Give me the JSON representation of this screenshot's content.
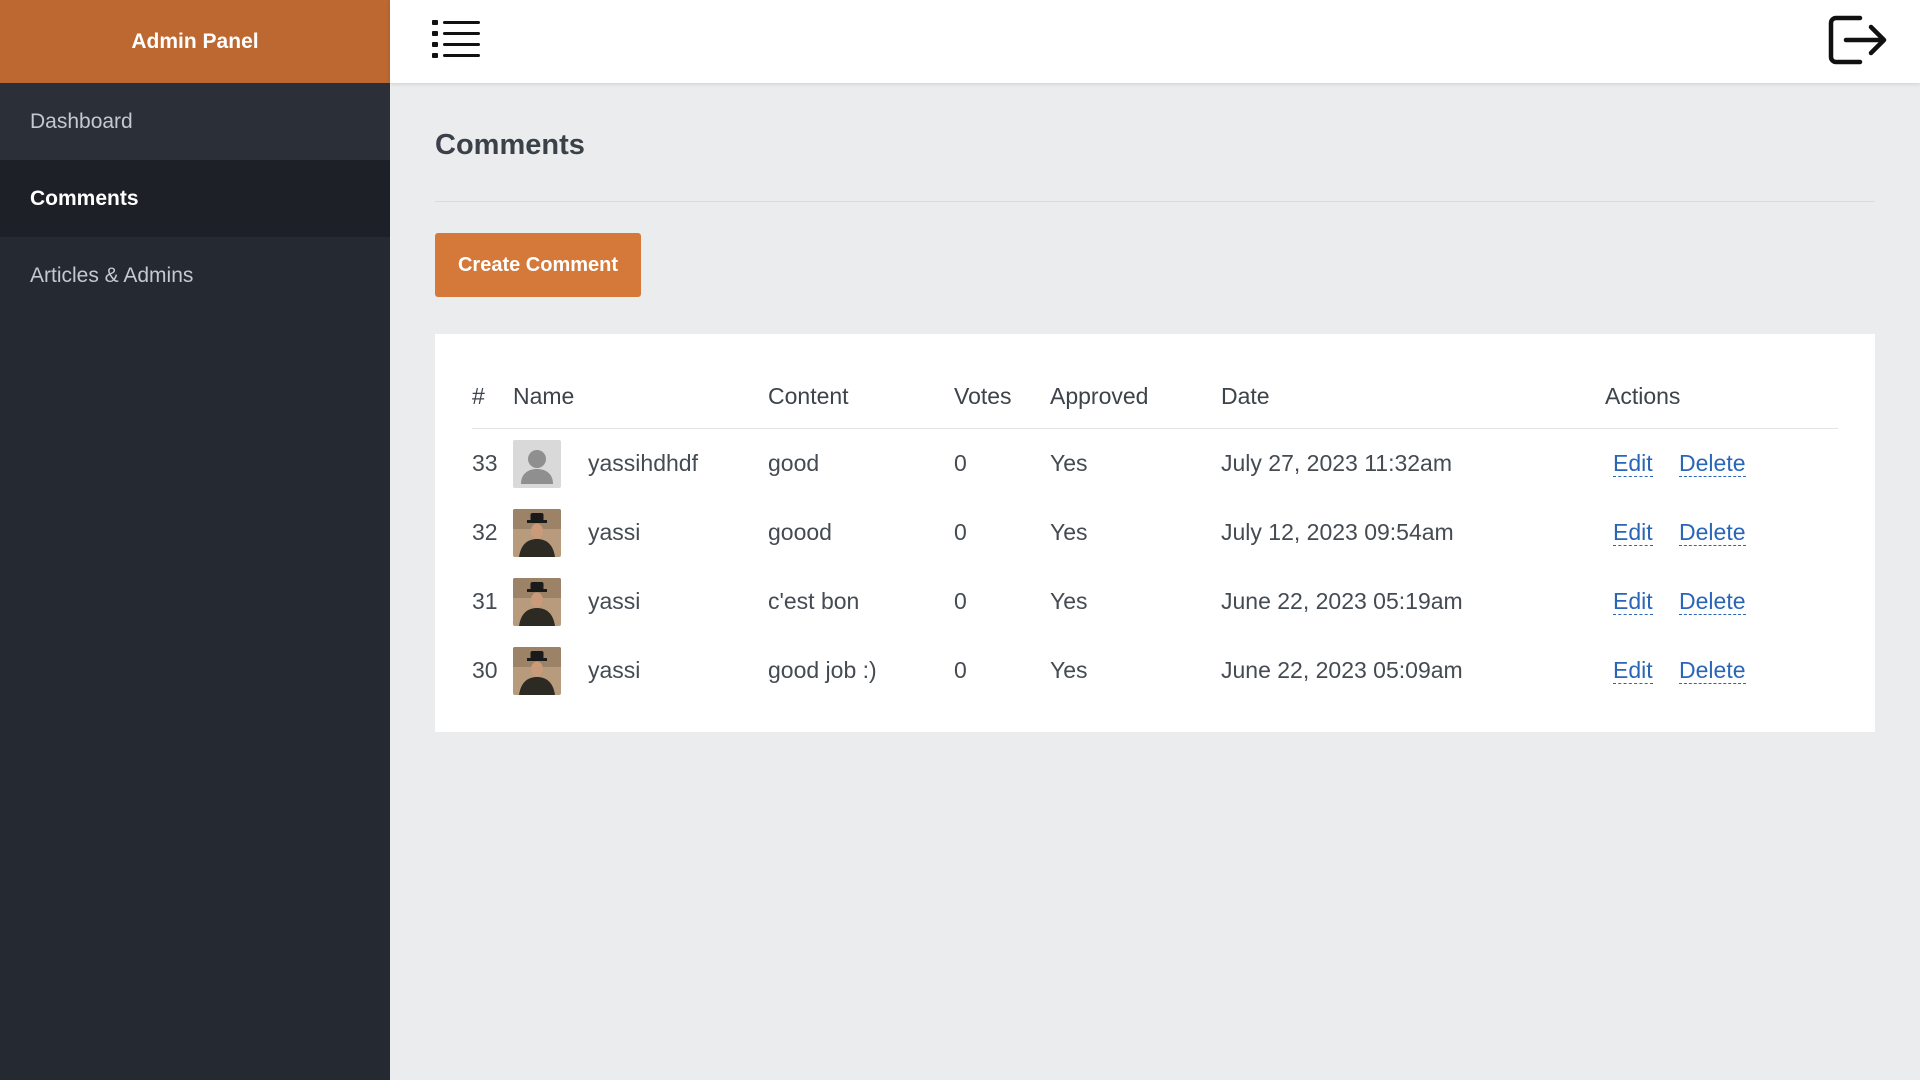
{
  "sidebar": {
    "brand": "Admin Panel",
    "items": [
      {
        "label": "Dashboard"
      },
      {
        "label": "Comments"
      },
      {
        "label": "Articles & Admins"
      }
    ]
  },
  "topbar": {
    "menu_icon": "hamburger-menu-icon",
    "logout_icon": "logout-icon"
  },
  "page": {
    "title": "Comments",
    "create_button": "Create Comment"
  },
  "table": {
    "headers": {
      "id": "#",
      "name": "Name",
      "content": "Content",
      "votes": "Votes",
      "approved": "Approved",
      "date": "Date",
      "actions": "Actions"
    },
    "rows": [
      {
        "id": "33",
        "avatar": "default-user-avatar",
        "name": "yassihdhdf",
        "content": "good",
        "votes": "0",
        "approved": "Yes",
        "date": "July 27, 2023 11:32am",
        "edit": "Edit",
        "delete": "Delete"
      },
      {
        "id": "32",
        "avatar": "man-in-hat-photo",
        "name": "yassi",
        "content": "goood",
        "votes": "0",
        "approved": "Yes",
        "date": "July 12, 2023 09:54am",
        "edit": "Edit",
        "delete": "Delete"
      },
      {
        "id": "31",
        "avatar": "man-in-hat-photo",
        "name": "yassi",
        "content": "c'est bon",
        "votes": "0",
        "approved": "Yes",
        "date": "June 22, 2023 05:19am",
        "edit": "Edit",
        "delete": "Delete"
      },
      {
        "id": "30",
        "avatar": "man-in-hat-photo",
        "name": "yassi",
        "content": "good job :)",
        "votes": "0",
        "approved": "Yes",
        "date": "June 22, 2023 05:09am",
        "edit": "Edit",
        "delete": "Delete"
      }
    ]
  },
  "colors": {
    "brand": "#bd6830",
    "button": "#d4793a",
    "sidebar": "#252932",
    "link": "#2a66b8"
  }
}
